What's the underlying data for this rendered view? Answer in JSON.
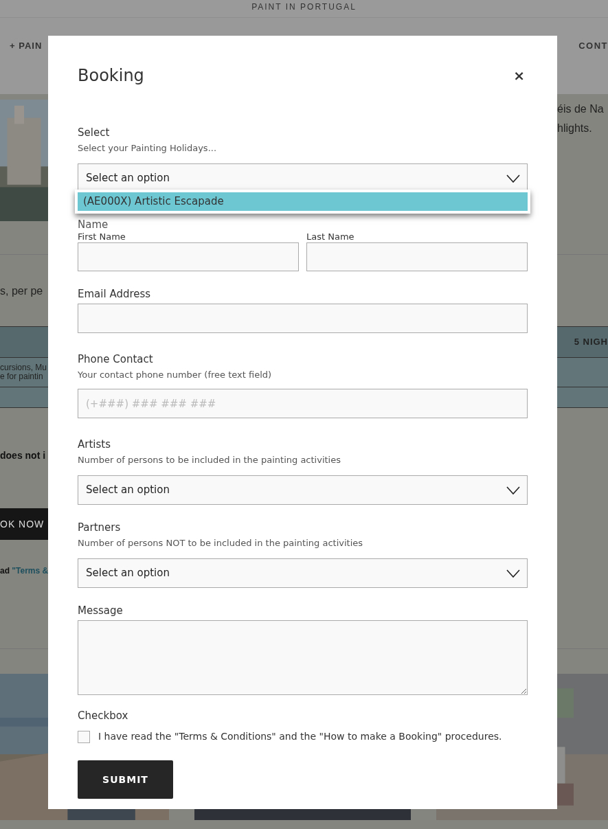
{
  "background": {
    "site_title": "PAINT IN PORTUGAL",
    "nav_left": "+ PAIN",
    "nav_right": "CONT",
    "intro_right": [
      "éis de Na",
      "hlights."
    ],
    "price_text": "s, per pe",
    "table": {
      "header_right": "5 NIGH",
      "row_left": [
        "cursions, Mu",
        "e for paintin"
      ]
    },
    "note_bold": "does not i",
    "book_button": "OK NOW",
    "terms": {
      "prefix": "ad ",
      "link": "\"Terms &"
    }
  },
  "modal": {
    "title": "Booking",
    "close": "×",
    "fields": [
      {
        "kind": "select",
        "label": "Select",
        "help": "Select your Painting Holidays...",
        "value": "Select an option",
        "open": true,
        "options": [
          {
            "label": "(AE000X) Artistic Escapade",
            "selected": true
          }
        ]
      },
      {
        "kind": "name",
        "label": "Name",
        "parts": [
          "First Name",
          "Last Name"
        ]
      },
      {
        "kind": "text",
        "label": "Email Address"
      },
      {
        "kind": "text",
        "label": "Phone Contact",
        "help": "Your contact phone number (free text field)",
        "placeholder": "(+###) ### ### ###"
      },
      {
        "kind": "select",
        "label": "Artists",
        "help": "Number of persons to be included in the painting activities",
        "value": "Select an option",
        "open": false
      },
      {
        "kind": "select",
        "label": "Partners",
        "help": "Number of persons NOT to be included in the painting activities",
        "value": "Select an option",
        "open": false
      },
      {
        "kind": "textarea",
        "label": "Message"
      },
      {
        "kind": "checkbox",
        "label": "Checkbox",
        "text": "I have read the \"Terms & Conditions\" and the \"How to make a Booking\" procedures.",
        "checked": false
      }
    ],
    "submit": "SUBMIT"
  }
}
